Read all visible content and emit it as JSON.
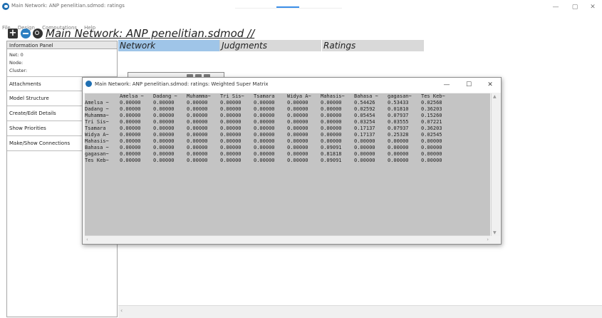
{
  "window": {
    "title": "Main Network: ANP penelitian.sdmod: ratings",
    "minimize_glyph": "—",
    "maximize_glyph": "▢",
    "close_glyph": "✕"
  },
  "menu": [
    "File",
    "Design",
    "Computations",
    "Help"
  ],
  "toolbar": {
    "plus_glyph": "+",
    "main_title": "Main Network: ANP penelitian.sdmod //"
  },
  "info_panel": {
    "header": "Information Panel",
    "net": "Net: 0",
    "node": "Node:",
    "cluster": "Cluster:",
    "buttons": [
      "Attachments",
      "Model Structure",
      "Create/Edit Details",
      "Show Priorities",
      "Make/Show Connections"
    ]
  },
  "tabs": [
    "Network",
    "Judgments",
    "Ratings"
  ],
  "popup": {
    "title": "Main Network: ANP penelitian.sdmod: ratings: Weighted Super Matrix",
    "minimize_glyph": "—",
    "maximize_glyph": "☐",
    "close_glyph": "✕",
    "matrix": {
      "columns": [
        "Amelsa ~",
        "Dadang ~",
        "Muhamma~",
        "Tri Sis~",
        "Tsamara",
        "Widya A~",
        "Mahasis~",
        "Bahasa ~",
        "gagasan~",
        "Tes Keb~"
      ],
      "rows": [
        {
          "label": "Amelsa ~",
          "values": [
            "0.00000",
            "0.00000",
            "0.00000",
            "0.00000",
            "0.00000",
            "0.00000",
            "0.00000",
            "0.54426",
            "0.53433",
            "0.02568"
          ]
        },
        {
          "label": "Dadang ~",
          "values": [
            "0.00000",
            "0.00000",
            "0.00000",
            "0.00000",
            "0.00000",
            "0.00000",
            "0.00000",
            "0.02592",
            "0.01810",
            "0.36203"
          ]
        },
        {
          "label": "Muhamma~",
          "values": [
            "0.00000",
            "0.00000",
            "0.00000",
            "0.00000",
            "0.00000",
            "0.00000",
            "0.00000",
            "0.05454",
            "0.07937",
            "0.15260"
          ]
        },
        {
          "label": "Tri Sis~",
          "values": [
            "0.00000",
            "0.00000",
            "0.00000",
            "0.00000",
            "0.00000",
            "0.00000",
            "0.00000",
            "0.03254",
            "0.03555",
            "0.07221"
          ]
        },
        {
          "label": "Tsamara",
          "values": [
            "0.00000",
            "0.00000",
            "0.00000",
            "0.00000",
            "0.00000",
            "0.00000",
            "0.00000",
            "0.17137",
            "0.07937",
            "0.36203"
          ]
        },
        {
          "label": "Widya A~",
          "values": [
            "0.00000",
            "0.00000",
            "0.00000",
            "0.00000",
            "0.00000",
            "0.00000",
            "0.00000",
            "0.17137",
            "0.25328",
            "0.02545"
          ]
        },
        {
          "label": "Mahasis~",
          "values": [
            "0.00000",
            "0.00000",
            "0.00000",
            "0.00000",
            "0.00000",
            "0.00000",
            "0.00000",
            "0.00000",
            "0.00000",
            "0.00000"
          ]
        },
        {
          "label": "Bahasa ~",
          "values": [
            "0.00000",
            "0.00000",
            "0.00000",
            "0.00000",
            "0.00000",
            "0.00000",
            "0.09091",
            "0.00000",
            "0.00000",
            "0.00000"
          ]
        },
        {
          "label": "gagasan~",
          "values": [
            "0.00000",
            "0.00000",
            "0.00000",
            "0.00000",
            "0.00000",
            "0.00000",
            "0.81818",
            "0.00000",
            "0.00000",
            "0.00000"
          ]
        },
        {
          "label": "Tes Keb~",
          "values": [
            "0.00000",
            "0.00000",
            "0.00000",
            "0.00000",
            "0.00000",
            "0.00000",
            "0.09091",
            "0.00000",
            "0.00000",
            "0.00000"
          ]
        }
      ]
    }
  }
}
